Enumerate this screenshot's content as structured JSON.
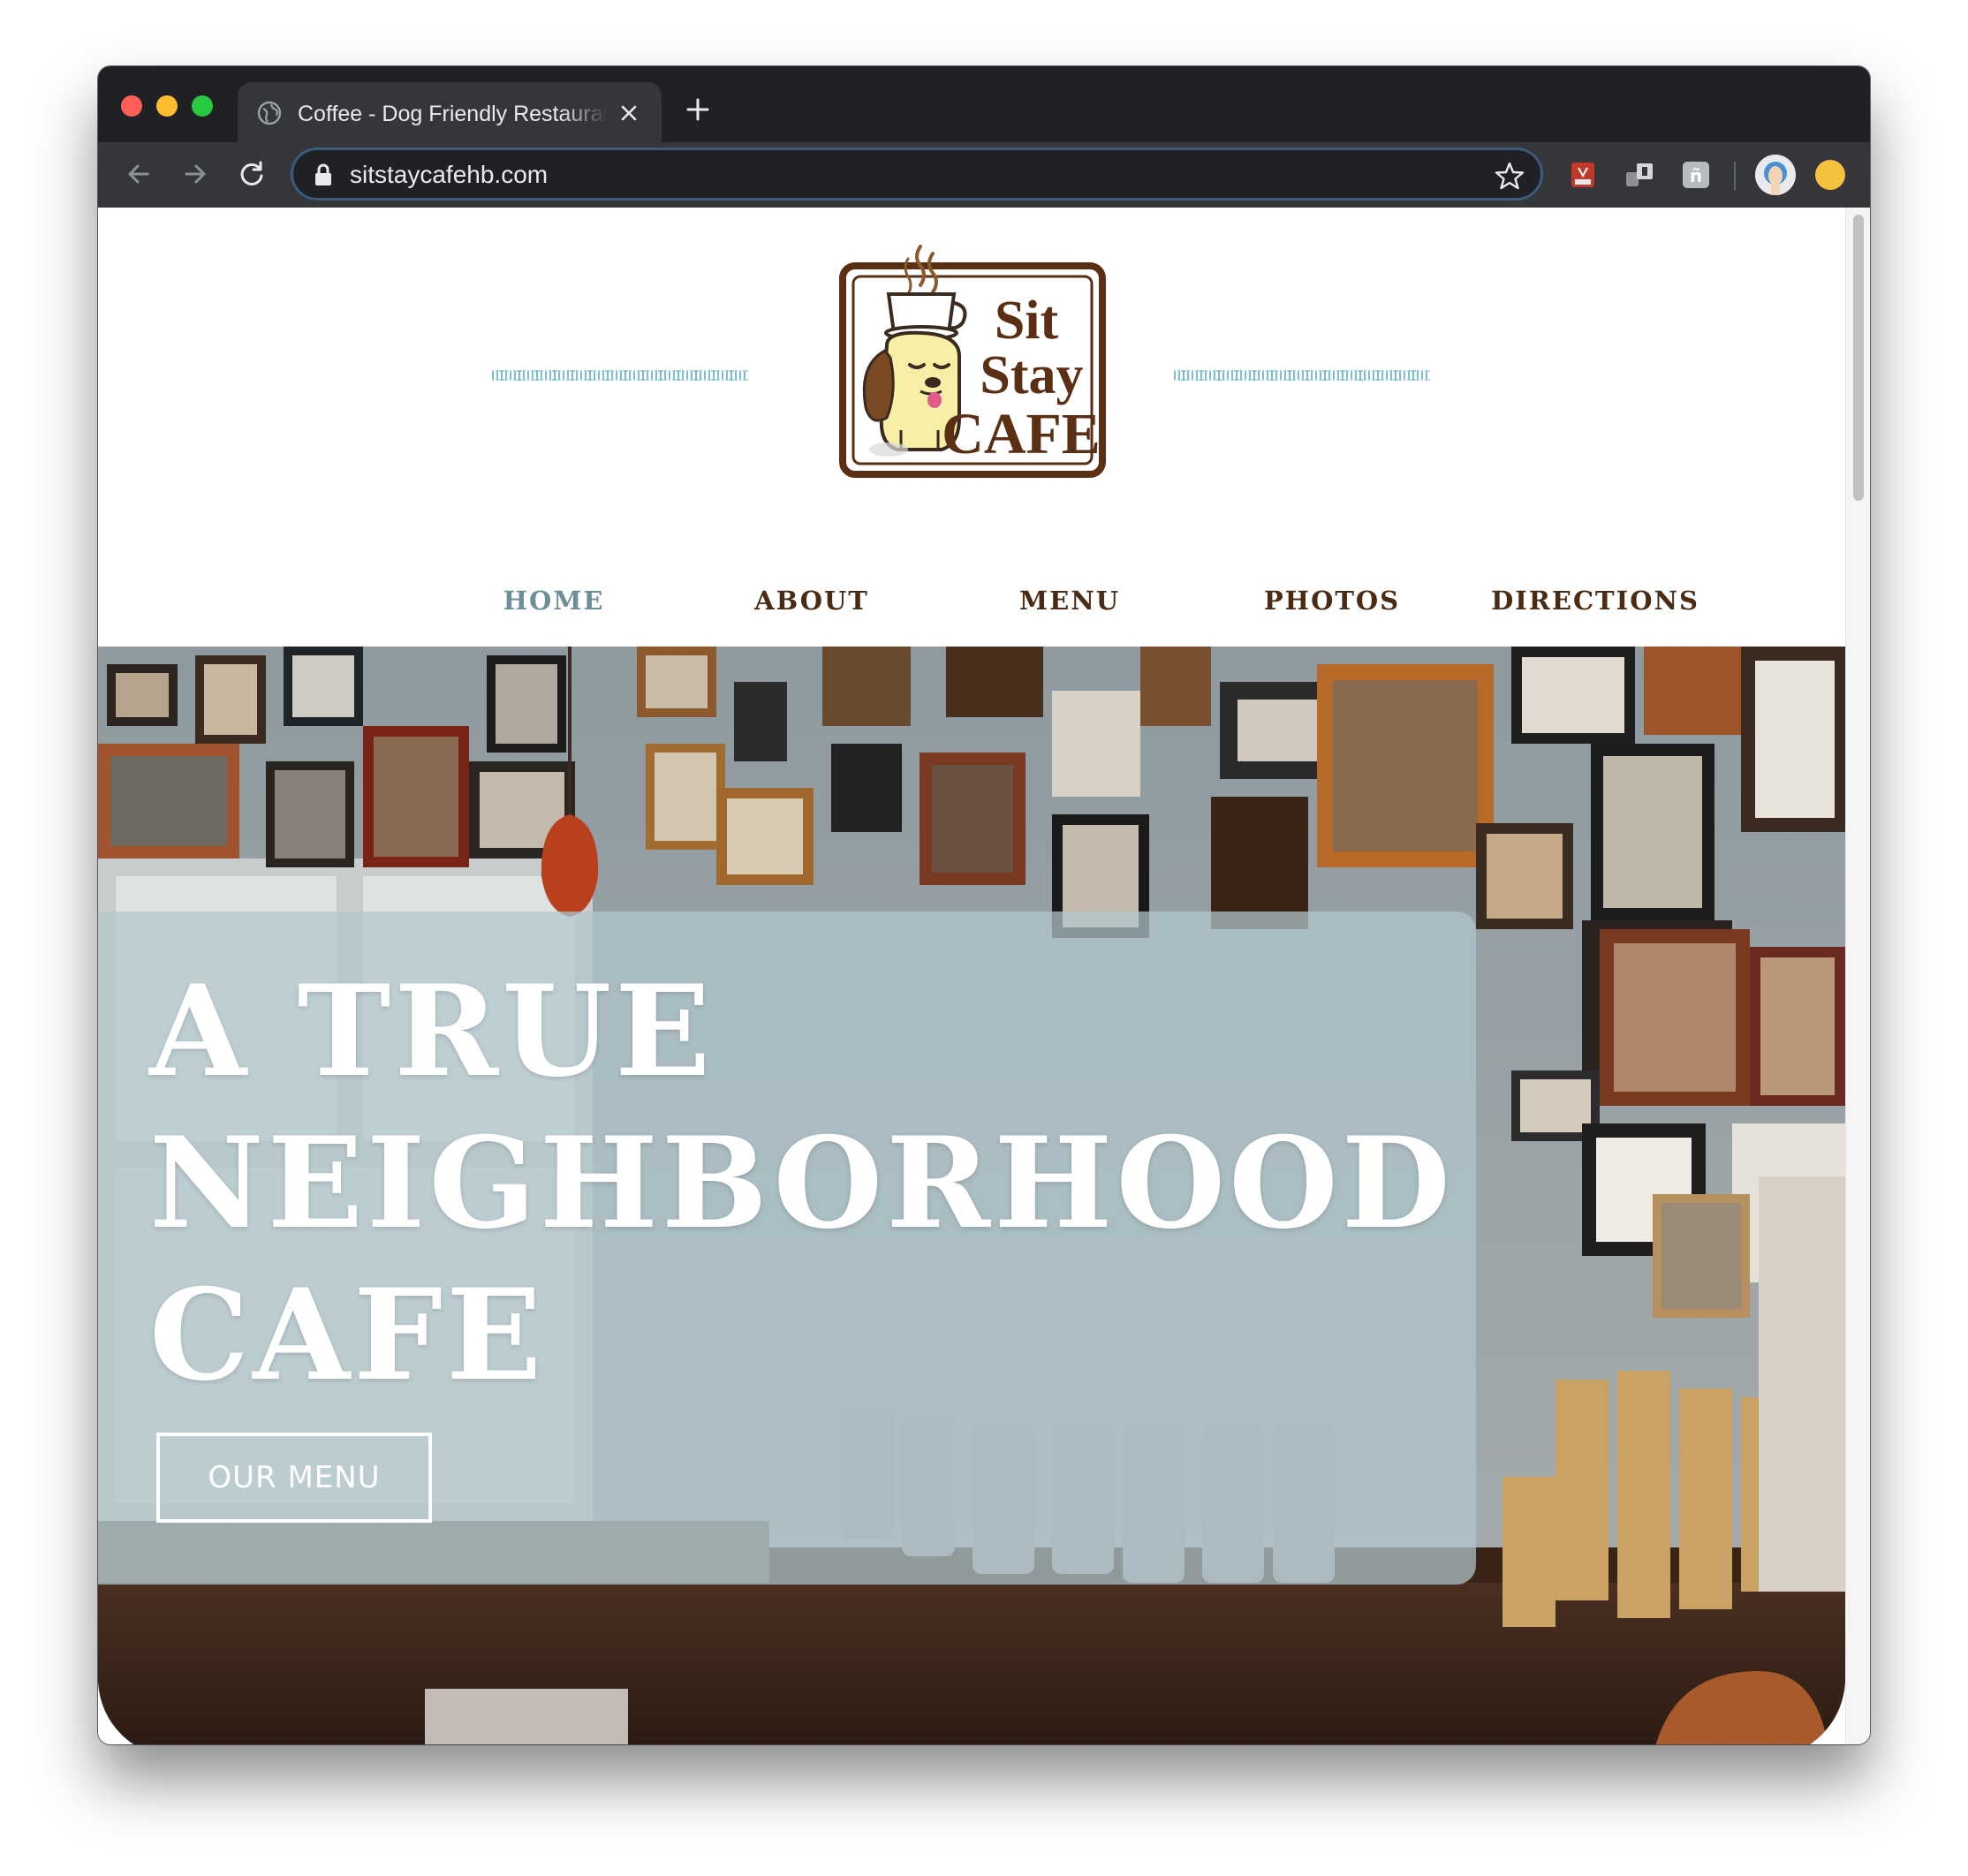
{
  "browser": {
    "tab_title": "Coffee - Dog Friendly Restaurant",
    "url": "sitstaycafehb.com",
    "icons": {
      "tab_favicon": "globe-icon",
      "tab_close": "close-icon",
      "new_tab": "plus-icon",
      "back": "arrow-left-icon",
      "forward": "arrow-right-icon",
      "reload": "reload-icon",
      "lock": "lock-icon",
      "bookmark": "star-icon"
    },
    "colors": {
      "titlebar": "#202124",
      "toolbar": "#35363a",
      "omnibox_border": "#3c5a7a"
    }
  },
  "site": {
    "logo": {
      "line1": "Sit",
      "line2": "Stay",
      "line3": "CAFE"
    },
    "nav": [
      {
        "label": "HOME",
        "active": true
      },
      {
        "label": "ABOUT",
        "active": false
      },
      {
        "label": "MENU",
        "active": false
      },
      {
        "label": "PHOTOS",
        "active": false
      },
      {
        "label": "DIRECTIONS",
        "active": false
      }
    ],
    "hero": {
      "heading": "A TRUE NEIGHBORHOOD CAFE",
      "button_label": "OUR MENU"
    },
    "colors": {
      "nav_text": "#4a2b14",
      "nav_active": "#6e8f9a",
      "accent_lines": "#6fb6cf",
      "logo_brown": "#5a2f14"
    }
  }
}
